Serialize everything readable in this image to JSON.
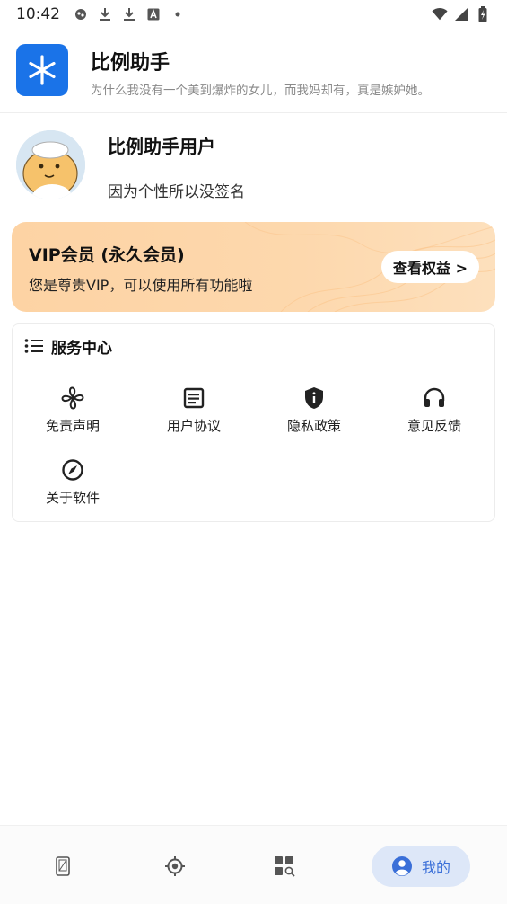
{
  "status_bar": {
    "time": "10:42",
    "left_icons": [
      "app-notification-icon",
      "download-icon",
      "download-icon",
      "text-icon",
      "dot-icon"
    ],
    "right_icons": [
      "wifi-icon",
      "signal-icon",
      "battery-charging-icon"
    ]
  },
  "app": {
    "title": "比例助手",
    "subtitle": "为什么我没有一个美到爆炸的女儿，而我妈却有，真是嫉妒她。"
  },
  "profile": {
    "name": "比例助手用户",
    "signature": "因为个性所以没签名"
  },
  "vip": {
    "title": "VIP会员 (永久会员)",
    "description": "您是尊贵VIP，可以使用所有功能啦",
    "button_label": "查看权益 >"
  },
  "services": {
    "title": "服务中心",
    "items": [
      {
        "label": "免责声明",
        "icon": "fan-icon"
      },
      {
        "label": "用户协议",
        "icon": "document-icon"
      },
      {
        "label": "隐私政策",
        "icon": "shield-info-icon"
      },
      {
        "label": "意见反馈",
        "icon": "headset-icon"
      },
      {
        "label": "关于软件",
        "icon": "compass-icon"
      }
    ]
  },
  "bottom_nav": {
    "items": [
      {
        "icon": "phone-screen-icon",
        "label": ""
      },
      {
        "icon": "locate-icon",
        "label": ""
      },
      {
        "icon": "grid-search-icon",
        "label": ""
      },
      {
        "icon": "user-icon",
        "label": "我的",
        "active": true
      }
    ]
  },
  "colors": {
    "accent": "#3a6fd8",
    "logo_bg": "#1a73e8",
    "vip_bg": "#fdd3a4",
    "active_nav_bg": "#dde7f8"
  }
}
